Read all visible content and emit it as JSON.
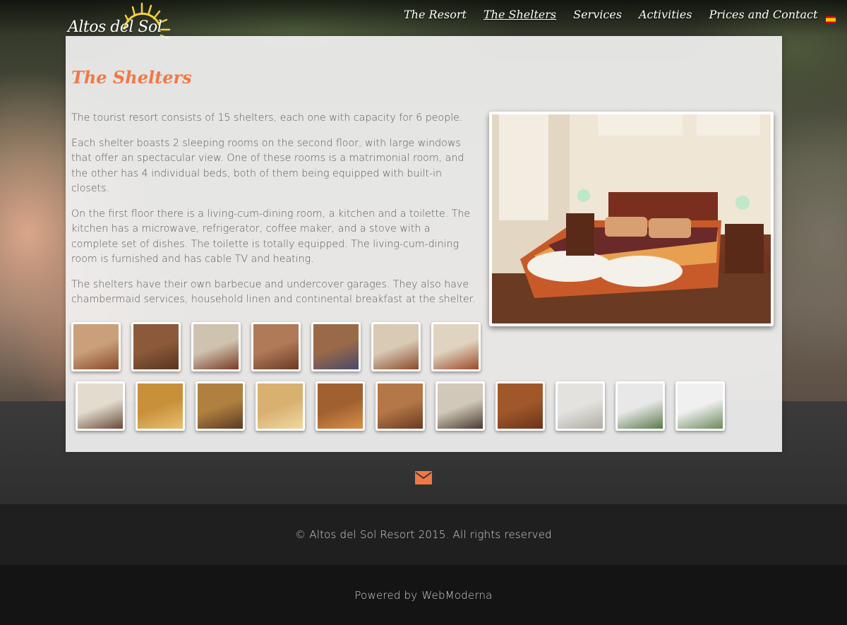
{
  "site": {
    "logo_text": "Altos del Sol"
  },
  "nav": {
    "items": [
      {
        "label": "The Resort",
        "active": false
      },
      {
        "label": "The Shelters",
        "active": true
      },
      {
        "label": "Services",
        "active": false
      },
      {
        "label": "Activities",
        "active": false
      },
      {
        "label": "Prices and Contact",
        "active": false
      }
    ],
    "language_flag": "spanish-flag-icon"
  },
  "page": {
    "title": "The Shelters",
    "paragraphs": [
      "The tourist resort consists of 15 shelters, each one with capacity for 6 people.",
      "Each shelter boasts 2 sleeping rooms on the second floor, with large windows that offer an spectacular view. One of these rooms is a matrimonial room, and the other has 4 individual beds, both of them being equipped with built-in closets.",
      "On the first floor there is a living-cum-dining room, a kitchen and a toilette. The kitchen has a microwave, refrigerator, coffee maker, and a stove with a complete set of dishes. The toilette is totally equipped. The living-cum-dining room is furnished and has cable TV and heating.",
      "The shelters have their own barbecue and undercover garages. They also have chambermaid services, household linen and continental breakfast at the shelter."
    ]
  },
  "gallery": {
    "row1": [
      {
        "name": "thumb-bedroom-1",
        "colors": [
          "#c9a07a",
          "#8a4a2a"
        ]
      },
      {
        "name": "thumb-stairs",
        "colors": [
          "#8c5a3a",
          "#5a3420"
        ]
      },
      {
        "name": "thumb-bunk-room-1",
        "colors": [
          "#cfc3b0",
          "#7a3a22"
        ]
      },
      {
        "name": "thumb-bunk-room-2",
        "colors": [
          "#b07a58",
          "#6a3a24"
        ]
      },
      {
        "name": "thumb-bunk-room-3",
        "colors": [
          "#9a6a48",
          "#4a4a6a"
        ]
      },
      {
        "name": "thumb-bedroom-2",
        "colors": [
          "#d8cab4",
          "#8a4a2a"
        ]
      },
      {
        "name": "thumb-bedroom-3",
        "colors": [
          "#e0d4c0",
          "#9a4a2a"
        ]
      }
    ],
    "row2": [
      {
        "name": "thumb-kitchen-1",
        "colors": [
          "#e2dccf",
          "#6a4a38"
        ]
      },
      {
        "name": "thumb-breakfast-1",
        "colors": [
          "#c8903a",
          "#e8c070"
        ]
      },
      {
        "name": "thumb-dining-1",
        "colors": [
          "#b08040",
          "#5a3a24"
        ]
      },
      {
        "name": "thumb-breakfast-2",
        "colors": [
          "#d8b070",
          "#f0d8a0"
        ]
      },
      {
        "name": "thumb-living-1",
        "colors": [
          "#a06030",
          "#d89048"
        ]
      },
      {
        "name": "thumb-dining-2",
        "colors": [
          "#b47848",
          "#6a3a20"
        ]
      },
      {
        "name": "thumb-kitchen-2",
        "colors": [
          "#d0c8b8",
          "#4a3a30"
        ]
      },
      {
        "name": "thumb-hallway",
        "colors": [
          "#a0582a",
          "#6a3418"
        ]
      },
      {
        "name": "thumb-bathroom",
        "colors": [
          "#e4e2de",
          "#b0aca4"
        ]
      },
      {
        "name": "thumb-exterior-1",
        "colors": [
          "#e8e8e8",
          "#5a7a4a"
        ]
      },
      {
        "name": "thumb-exterior-2",
        "colors": [
          "#f0f0f0",
          "#6a8a5a"
        ]
      }
    ]
  },
  "footer": {
    "copyright": "© Altos del Sol Resort 2015. All rights reserved",
    "powered_by_label": "Powered by",
    "powered_by_name": "WebModerna"
  },
  "colors": {
    "accent": "#f07845",
    "body_text": "#5a5a5a"
  }
}
